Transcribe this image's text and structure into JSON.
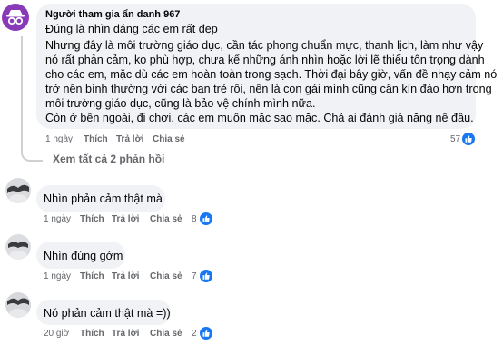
{
  "main_comment": {
    "author": "Người tham gia ẩn danh 967",
    "avatar_icon": "anonymous-avatar-icon",
    "lines": [
      "Đúng là nhìn dáng các em rất đẹp",
      "Nhưng đây là môi trường giáo dục, cần tác phong chuẩn mực, thanh lịch, làm như vậy",
      "nó rất phản cảm, ko phù hợp, chưa kể những ánh nhìn hoặc lời lẽ thiếu tôn trọng dành",
      "cho các em, mặc dù các em hoàn toàn trong sạch. Thời đại bây giờ, vấn đề nhạy cảm nó",
      "trở nên bình thường với các bạn trẻ rồi, nên là con gái mình cũng cần kín đáo hơn trong",
      "môi trường giáo dục, cũng là bảo vệ chính mình nữa.",
      "Còn ở bên ngoài, đi chơi, các em muốn mặc sao mặc. Chả ai đánh giá nặng nề đâu."
    ],
    "time": "1 ngày",
    "like_label": "Thích",
    "reply_label": "Trả lời",
    "share_label": "Chia sẻ",
    "like_count": "57"
  },
  "view_all_replies": "Xem tất cả 2 phản hồi",
  "comments": [
    {
      "text": "Nhìn phản cảm thật mà",
      "time": "1 ngày",
      "like_label": "Thích",
      "reply_label": "Trả lời",
      "share_label": "Chia sẻ",
      "like_count": "8"
    },
    {
      "text": "Nhìn đúng gớm",
      "time": "1 ngày",
      "like_label": "Thích",
      "reply_label": "Trả lời",
      "share_label": "Chia sẻ",
      "like_count": "7"
    },
    {
      "text": "Nó phản cảm thật mà =))",
      "time": "20 giờ",
      "like_label": "Thích",
      "reply_label": "Trả lời",
      "share_label": "Chia sẻ",
      "like_count": "2"
    }
  ],
  "colors": {
    "bubble": "#f0f2f5",
    "like_blue": "#1877f2",
    "avatar_purple": "#8a3ab9",
    "meta_gray": "#65676b"
  },
  "like_icon": "thumbs-up-icon"
}
